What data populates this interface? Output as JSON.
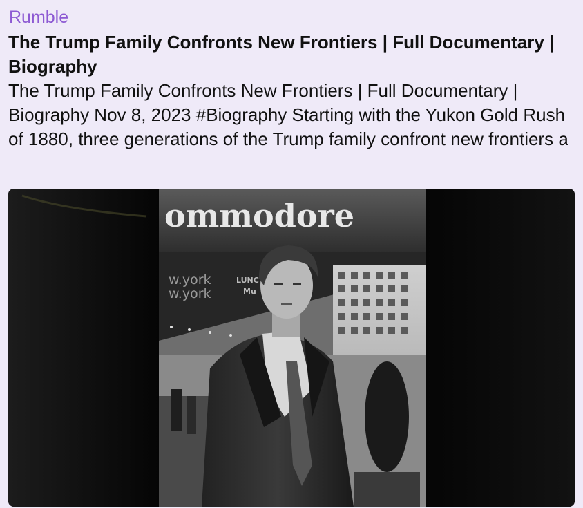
{
  "preview": {
    "site_name": "Rumble",
    "title": "The Trump Family Confronts New Frontiers | Full Documentary | Biography",
    "description": "The Trump Family Confronts New Frontiers | Full Documentary | Biography Nov 8, 2023 #Biography Starting with the Yukon Gold Rush of 1880, three generations of the Trump family confront new frontiers a",
    "thumbnail": {
      "sign_text": "ommodore",
      "awning_text_1": "w.york",
      "awning_text_2": "w.york",
      "awning_lunch": "LUNC",
      "awning_mu": "Mu"
    }
  }
}
